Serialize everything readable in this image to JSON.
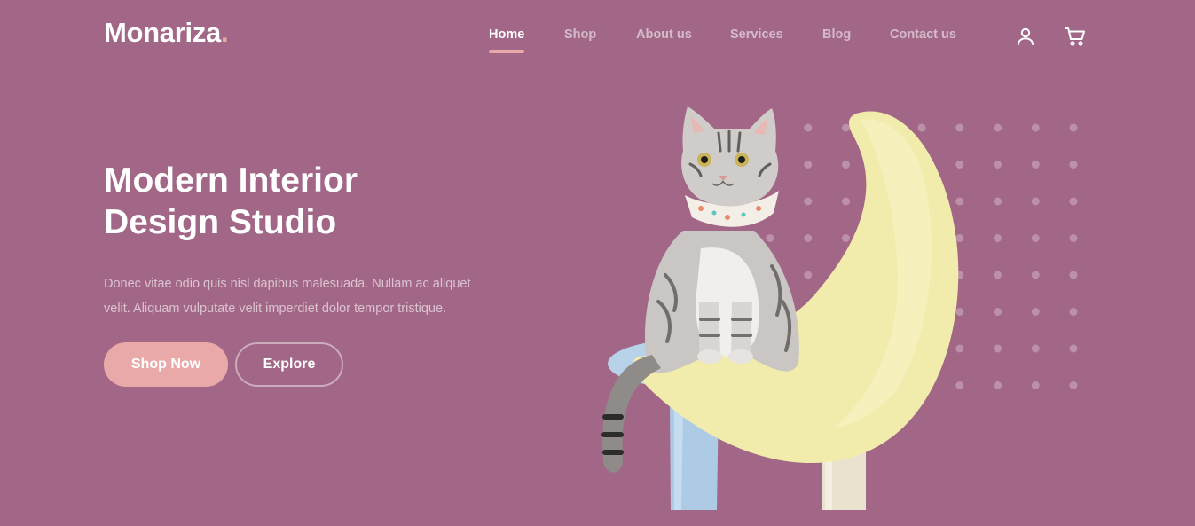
{
  "brand": {
    "name": "Monariza",
    "dot": "."
  },
  "nav": {
    "items": [
      {
        "label": "Home",
        "active": true
      },
      {
        "label": "Shop",
        "active": false
      },
      {
        "label": "About us",
        "active": false
      },
      {
        "label": "Services",
        "active": false
      },
      {
        "label": "Blog",
        "active": false
      },
      {
        "label": "Contact us",
        "active": false
      }
    ]
  },
  "header_icons": [
    "user-icon",
    "cart-icon"
  ],
  "hero": {
    "title_line1": "Modern Interior",
    "title_line2": "Design Studio",
    "description": "Donec vitae odio quis nisl dapibus malesuada. Nullam ac aliquet velit. Aliquam vulputate velit imperdiet dolor tempor tristique.",
    "primary_button": "Shop Now",
    "secondary_button": "Explore"
  },
  "colors": {
    "background": "#a26787",
    "accent": "#eaa9a9",
    "text": "#ffffff"
  }
}
